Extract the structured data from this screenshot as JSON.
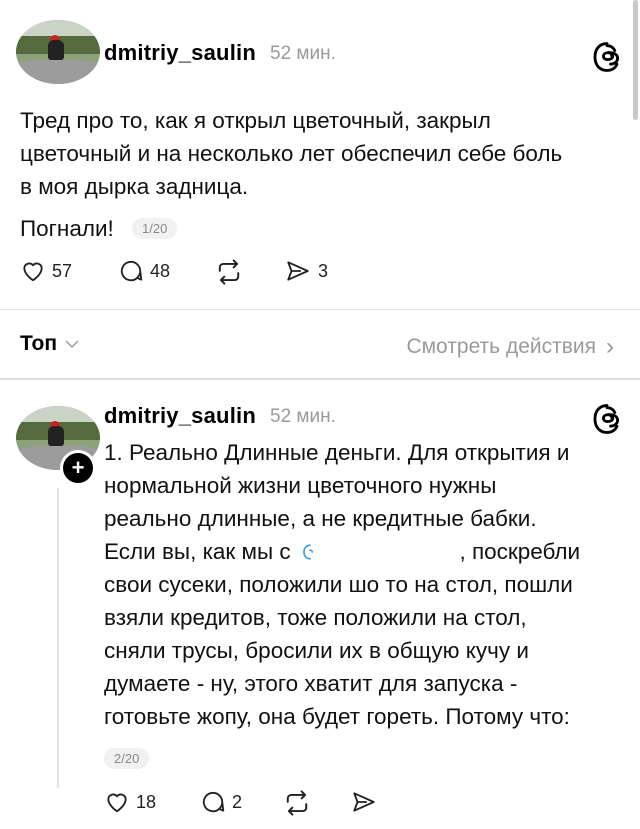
{
  "post1": {
    "username": "dmitriy_saulin",
    "time": "52 мин.",
    "text_lines": [
      "Тред про то, как я открыл цветочный, закрыл",
      "цветочный и на несколько лет обеспечил себе боль",
      "в моя дырка задница."
    ],
    "last_line": "Погнали!",
    "counter": "1/20",
    "likes": "57",
    "comments": "48",
    "shares": "3"
  },
  "sort_bar": {
    "label": "Топ",
    "link": "Смотреть действия",
    "link_arrow": "›"
  },
  "post2": {
    "username": "dmitriy_saulin",
    "time": "52 мин.",
    "text_lines": [
      "1. Реально Длинные деньги. Для открытия и",
      "нормальной жизни цветочного нужны",
      "реально длинные, а не кредитные бабки.",
      "Если вы, как мы с",
      ", поскребли",
      "свои сусеки, положили шо то на стол, пошли",
      "взяли кредитов, тоже положили на стол,",
      "сняли трусы, бросили их в общую кучу и",
      "думаете - ну, этого хватит для запуска -",
      "готовьте жопу, она будет гореть. Потому что:"
    ],
    "counter": "2/20",
    "likes": "18",
    "comments": "2"
  },
  "icons": {
    "threads": "threads-logo-icon",
    "like": "heart-icon",
    "comment": "comment-bubble-icon",
    "repost": "repost-arrows-icon",
    "share": "send-arrow-icon",
    "follow": "plus-badge-icon",
    "mention": "threads-mention-icon"
  },
  "colors": {
    "text": "#111111",
    "muted": "#9a9a9a",
    "mention": "#3a9fd6",
    "divider": "#e4e4e4"
  }
}
